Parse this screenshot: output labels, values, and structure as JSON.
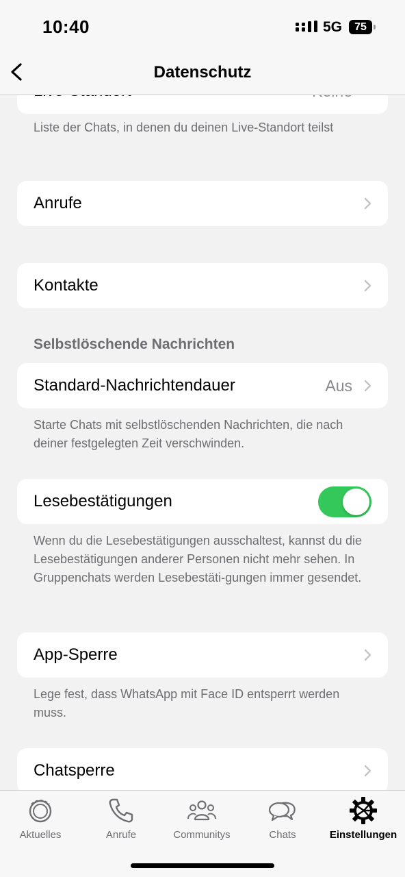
{
  "status_bar": {
    "time": "10:40",
    "network": "5G",
    "battery": "75"
  },
  "nav": {
    "title": "Datenschutz",
    "back_icon": "chevron-left-icon"
  },
  "live_location": {
    "label": "Live-Standort",
    "value": "Keine",
    "footnote": "Liste der Chats, in denen du deinen Live-Standort teilst"
  },
  "calls_item": {
    "label": "Anrufe"
  },
  "contacts_item": {
    "label": "Kontakte"
  },
  "disappearing": {
    "header": "Selbstlöschende Nachrichten",
    "label": "Standard-Nachrichtendauer",
    "value": "Aus",
    "footnote": "Starte Chats mit selbstlöschenden Nachrichten, die nach deiner festgelegten Zeit verschwinden."
  },
  "read_receipts": {
    "label": "Lesebestätigungen",
    "enabled": true,
    "footnote": "Wenn du die Lesebestätigungen ausschaltest, kannst du die Lesebestätigungen anderer Personen nicht mehr sehen. In Gruppenchats werden Lesebestäti-gungen immer gesendet."
  },
  "app_lock": {
    "label": "App-Sperre",
    "footnote": "Lege fest, dass WhatsApp mit Face ID entsperrt werden muss."
  },
  "chat_lock": {
    "label": "Chatsperre"
  },
  "tabs": [
    {
      "label": "Aktuelles",
      "icon": "updates-icon",
      "active": false
    },
    {
      "label": "Anrufe",
      "icon": "phone-icon",
      "active": false
    },
    {
      "label": "Communitys",
      "icon": "communities-icon",
      "active": false
    },
    {
      "label": "Chats",
      "icon": "chats-icon",
      "active": false
    },
    {
      "label": "Einstellungen",
      "icon": "settings-gear-icon",
      "active": true
    }
  ],
  "colors": {
    "toggle_on": "#34c759",
    "background": "#f2f2f2",
    "secondary_text": "#6d6d72"
  }
}
